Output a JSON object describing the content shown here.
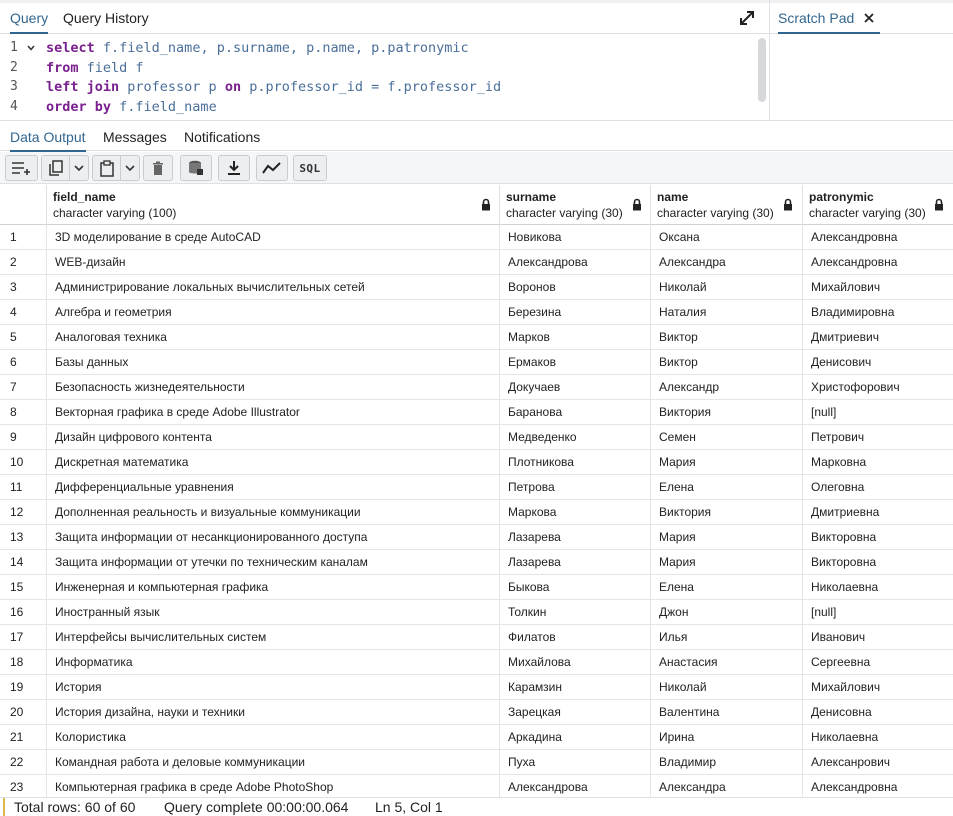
{
  "query_tabs": {
    "query": "Query",
    "history": "Query History"
  },
  "scratch_pad": {
    "label": "Scratch Pad"
  },
  "editor": {
    "line_numbers": [
      "1",
      "2",
      "3",
      "4"
    ],
    "lines": [
      {
        "kw": "select",
        "rest": " f.field_name, p.surname, p.name, p.patronymic"
      },
      {
        "kw": "from",
        "rest": " field f"
      },
      {
        "kw": "left join",
        "rest": " professor p ",
        "kw2": "on",
        "rest2": " p.professor_id = f.professor_id"
      },
      {
        "kw": "order by",
        "rest": " f.field_name"
      }
    ]
  },
  "result_tabs": {
    "data_output": "Data Output",
    "messages": "Messages",
    "notifications": "Notifications"
  },
  "toolbar": {
    "sql_label": "SQL"
  },
  "columns": [
    {
      "name": "field_name",
      "type": "character varying (100)"
    },
    {
      "name": "surname",
      "type": "character varying (30)"
    },
    {
      "name": "name",
      "type": "character varying (30)"
    },
    {
      "name": "patronymic",
      "type": "character varying (30)"
    }
  ],
  "rows": [
    {
      "n": "1",
      "field_name": "3D моделирование в среде AutoCAD",
      "surname": "Новикова",
      "name": "Оксана",
      "patronymic": "Александровна"
    },
    {
      "n": "2",
      "field_name": "WEB-дизайн",
      "surname": "Александрова",
      "name": "Александра",
      "patronymic": "Александровна"
    },
    {
      "n": "3",
      "field_name": "Администрирование локальных вычислительных сетей",
      "surname": "Воронов",
      "name": "Николай",
      "patronymic": "Михайлович"
    },
    {
      "n": "4",
      "field_name": "Алгебра и геометрия",
      "surname": "Березина",
      "name": "Наталия",
      "patronymic": "Владимировна"
    },
    {
      "n": "5",
      "field_name": "Аналоговая техника",
      "surname": "Марков",
      "name": "Виктор",
      "patronymic": "Дмитриевич"
    },
    {
      "n": "6",
      "field_name": "Базы данных",
      "surname": "Ермаков",
      "name": "Виктор",
      "patronymic": "Денисович"
    },
    {
      "n": "7",
      "field_name": "Безопасность жизнедеятельности",
      "surname": "Докучаев",
      "name": "Александр",
      "patronymic": "Христофорович"
    },
    {
      "n": "8",
      "field_name": "Векторная графика в среде Adobe Illustrator",
      "surname": "Баранова",
      "name": "Виктория",
      "patronymic": "[null]"
    },
    {
      "n": "9",
      "field_name": "Дизайн цифрового контента",
      "surname": "Медведенко",
      "name": "Семен",
      "patronymic": "Петрович"
    },
    {
      "n": "10",
      "field_name": "Дискретная математика",
      "surname": "Плотникова",
      "name": "Мария",
      "patronymic": "Марковна"
    },
    {
      "n": "11",
      "field_name": "Дифференциальные уравнения",
      "surname": "Петрова",
      "name": "Елена",
      "patronymic": "Олеговна"
    },
    {
      "n": "12",
      "field_name": "Дополненная реальность и визуальные коммуникации",
      "surname": "Маркова",
      "name": "Виктория",
      "patronymic": "Дмитриевна"
    },
    {
      "n": "13",
      "field_name": "Защита информации от несанкционированного доступа",
      "surname": "Лазарева",
      "name": "Мария",
      "patronymic": "Викторовна"
    },
    {
      "n": "14",
      "field_name": "Защита информации от утечки по техническим каналам",
      "surname": "Лазарева",
      "name": "Мария",
      "patronymic": "Викторовна"
    },
    {
      "n": "15",
      "field_name": "Инженерная и компьютерная графика",
      "surname": "Быкова",
      "name": "Елена",
      "patronymic": "Николаевна"
    },
    {
      "n": "16",
      "field_name": "Иностранный язык",
      "surname": "Толкин",
      "name": "Джон",
      "patronymic": "[null]"
    },
    {
      "n": "17",
      "field_name": "Интерфейсы вычислительных систем",
      "surname": "Филатов",
      "name": "Илья",
      "patronymic": "Иванович"
    },
    {
      "n": "18",
      "field_name": "Информатика",
      "surname": "Михайлова",
      "name": "Анастасия",
      "patronymic": "Сергеевна"
    },
    {
      "n": "19",
      "field_name": "История",
      "surname": "Карамзин",
      "name": "Николай",
      "patronymic": "Михайлович"
    },
    {
      "n": "20",
      "field_name": "История дизайна, науки и техники",
      "surname": "Зарецкая",
      "name": "Валентина",
      "patronymic": "Денисовна"
    },
    {
      "n": "21",
      "field_name": "Колористика",
      "surname": "Аркадина",
      "name": "Ирина",
      "patronymic": "Николаевна"
    },
    {
      "n": "22",
      "field_name": "Командная работа и деловые коммуникации",
      "surname": "Пуха",
      "name": "Владимир",
      "patronymic": "Алексанрович"
    },
    {
      "n": "23",
      "field_name": "Компьютерная графика в среде Adobe PhotoShop",
      "surname": "Александрова",
      "name": "Александра",
      "patronymic": "Александровна"
    }
  ],
  "status": {
    "total_rows": "Total rows: 60 of 60",
    "query_complete": "Query complete 00:00:00.064",
    "cursor": "Ln 5, Col 1"
  },
  "colors": {
    "accent": "#326690",
    "keyword": "#7a1f8e",
    "identifier": "#4a6f9a"
  }
}
